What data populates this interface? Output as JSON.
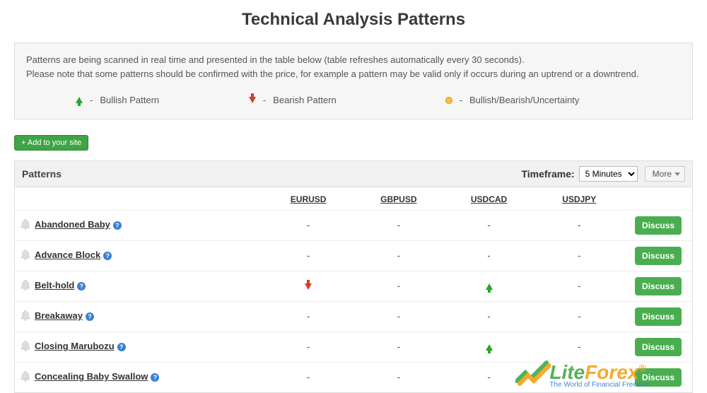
{
  "title": "Technical Analysis Patterns",
  "infobox": {
    "line1": "Patterns are being scanned in real time and presented in the table below (table refreshes automatically every 30 seconds).",
    "line2": "Please note that some patterns should be confirmed with the price, for example a pattern may be valid only if occurs during an uptrend or a downtrend."
  },
  "legend": {
    "bullish": "Bullish Pattern",
    "bearish": "Bearish Pattern",
    "uncertain": "Bullish/Bearish/Uncertainty"
  },
  "add_button": "+ Add to your site",
  "panel": {
    "title": "Patterns",
    "timeframe_label": "Timeframe:",
    "timeframe_value": "5 Minutes",
    "more": "More"
  },
  "columns": [
    "EURUSD",
    "GBPUSD",
    "USDCAD",
    "USDJPY"
  ],
  "discuss_label": "Discuss",
  "rows": [
    {
      "name": "Abandoned Baby",
      "cells": [
        "-",
        "-",
        "-",
        "-"
      ]
    },
    {
      "name": "Advance Block",
      "cells": [
        "-",
        "-",
        "-",
        "-"
      ]
    },
    {
      "name": "Belt-hold",
      "cells": [
        "down",
        "-",
        "up",
        "-"
      ]
    },
    {
      "name": "Breakaway",
      "cells": [
        "-",
        "-",
        "-",
        "-"
      ]
    },
    {
      "name": "Closing Marubozu",
      "cells": [
        "-",
        "-",
        "up",
        "-"
      ]
    },
    {
      "name": "Concealing Baby Swallow",
      "cells": [
        "-",
        "-",
        "-",
        "-"
      ]
    }
  ],
  "watermark": {
    "brand_a": "Lite",
    "brand_b": "Forex",
    "tag": "The World of Financial Freedom"
  }
}
